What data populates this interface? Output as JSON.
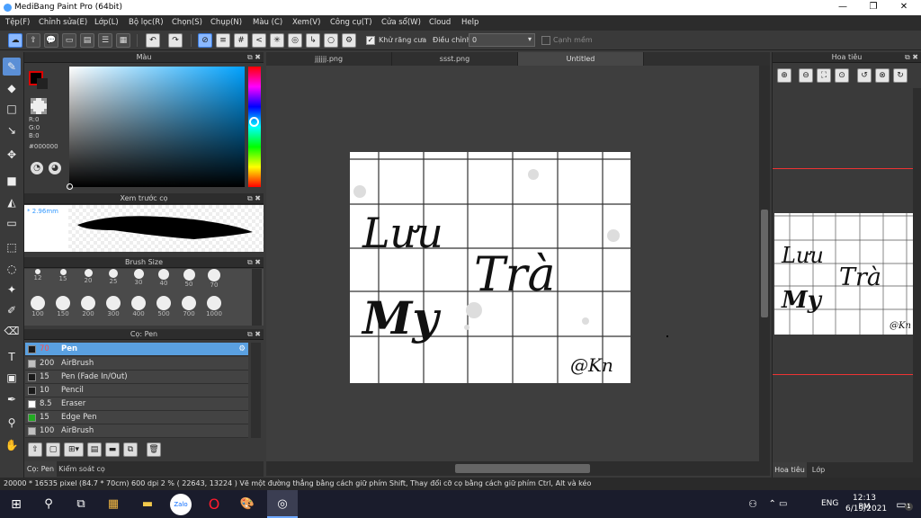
{
  "window": {
    "title": "MediBang Paint Pro (64bit)"
  },
  "menu": [
    "Tệp(F)",
    "Chỉnh sửa(E)",
    "Lớp(L)",
    "Bộ lọc(R)",
    "Chọn(S)",
    "Chụp(N)",
    "Màu (C)",
    "Xem(V)",
    "Công cụ(T)",
    "Cửa sổ(W)",
    "Cloud",
    "Help"
  ],
  "toolbar": {
    "antialias_label": "Khử răng cưa",
    "adjust_label": "Điều chỉnh",
    "adjust_value": "0",
    "smooth_label": "Cạnh mềm"
  },
  "color_panel": {
    "title": "Màu",
    "r": "R:0",
    "g": "G:0",
    "b": "B:0",
    "hex": "#000000",
    "foreground": "#000000"
  },
  "preview_panel": {
    "title": "Xem trước cọ",
    "size": "2.96mm"
  },
  "brush_size_panel": {
    "title": "Brush Size",
    "sizes": [
      "12",
      "15",
      "20",
      "25",
      "30",
      "40",
      "50",
      "70",
      "100",
      "150",
      "200",
      "300",
      "400",
      "500",
      "700",
      "1000"
    ]
  },
  "brush_panel": {
    "title": "Cọ: Pen",
    "items": [
      {
        "size": "70",
        "name": "Pen",
        "color": "#1a1a1a"
      },
      {
        "size": "200",
        "name": "AirBrush",
        "color": "#c0c0c0"
      },
      {
        "size": "15",
        "name": "Pen (Fade In/Out)",
        "color": "#1a1a1a"
      },
      {
        "size": "10",
        "name": "Pencil",
        "color": "#1a1a1a"
      },
      {
        "size": "8.5",
        "name": "Eraser",
        "color": "#ffffff"
      },
      {
        "size": "15",
        "name": "Edge Pen",
        "color": "#22aa22"
      },
      {
        "size": "100",
        "name": "AirBrush",
        "color": "#c0c0c0"
      }
    ]
  },
  "left_tabs": [
    "Cọ: Pen",
    "Kiểm soát cọ"
  ],
  "doc_tabs": [
    "jjjjjj.png",
    "ssst.png",
    "Untitled"
  ],
  "canvas_text": {
    "line1": "Lưu",
    "line2": "Trà",
    "line3": "My",
    "signature": "@Kn"
  },
  "navigator": {
    "title": "Hoa tiêu",
    "tabs": [
      "Hoa tiêu",
      "Lớp"
    ]
  },
  "statusbar": "20000 * 16535 pixel   (84.7 * 70cm)   600 dpi   2 %   ( 22643, 13224 )   Vẽ một đường thẳng bằng cách giữ phím Shift, Thay đổi cỡ cọ bằng cách giữ phím Ctrl, Alt và kéo",
  "taskbar": {
    "lang": "ENG",
    "time": "12:13 PM",
    "date": "6/19/2021",
    "notif_count": "1"
  }
}
